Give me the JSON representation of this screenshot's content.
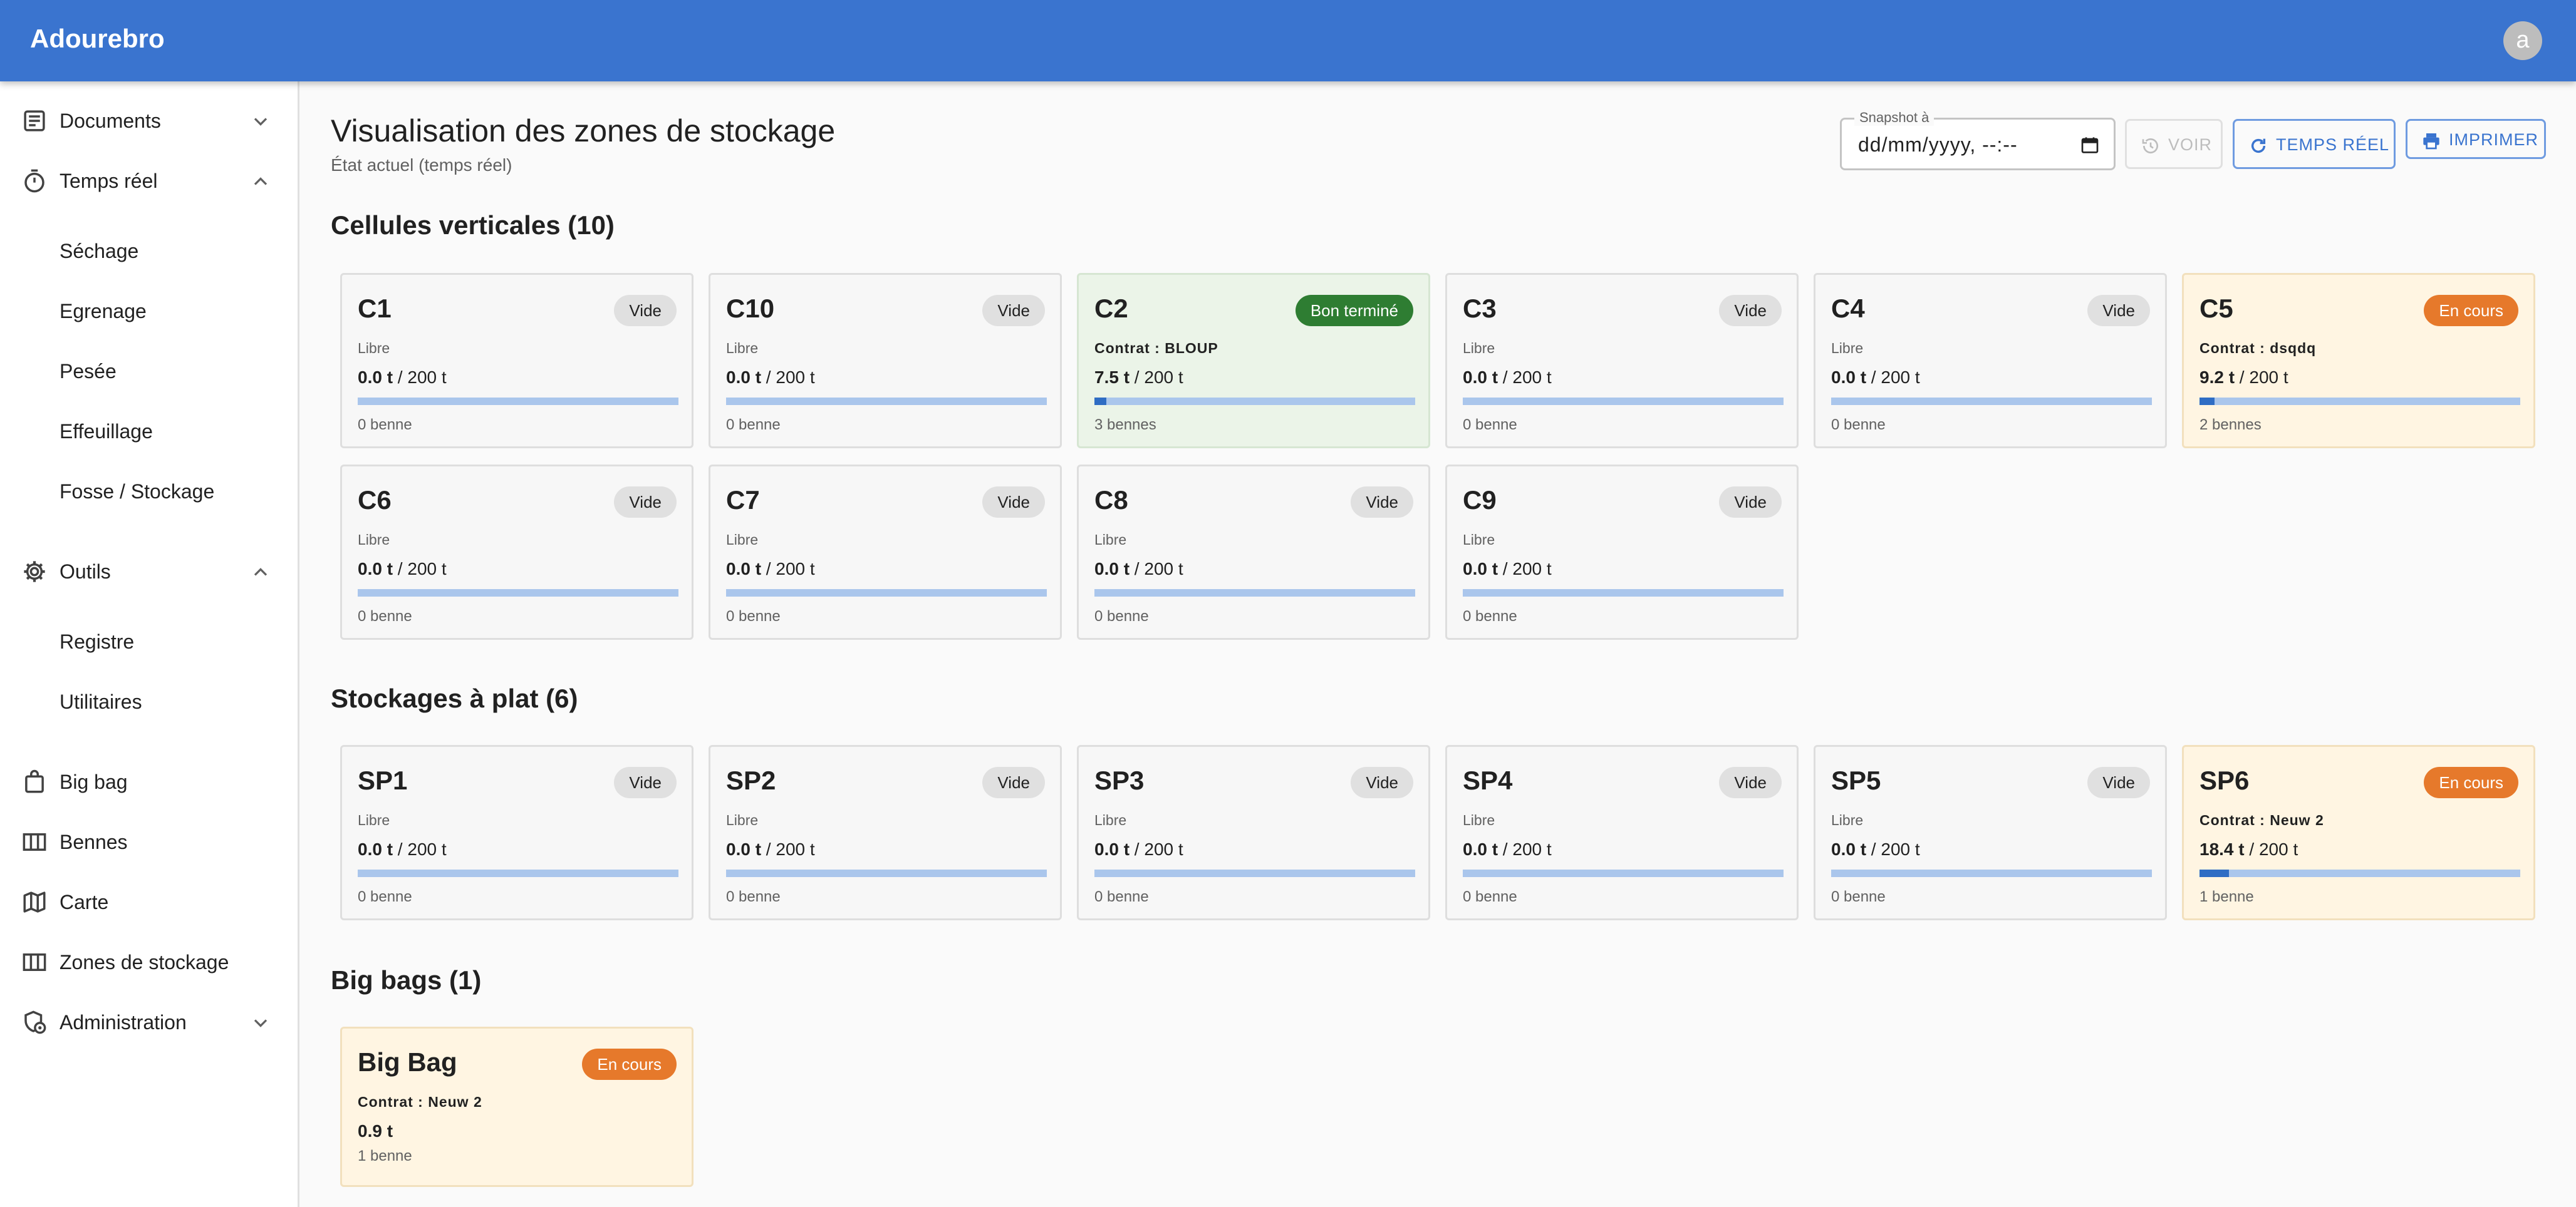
{
  "app": {
    "title": "Adourebro",
    "avatar_letter": "a"
  },
  "sidebar": {
    "documents": "Documents",
    "temps_reel": "Temps réel",
    "temps_reel_items": [
      "Séchage",
      "Egrenage",
      "Pesée",
      "Effeuillage",
      "Fosse / Stockage"
    ],
    "outils": "Outils",
    "outils_items": [
      "Registre",
      "Utilitaires"
    ],
    "big_bag": "Big bag",
    "bennes": "Bennes",
    "carte": "Carte",
    "zones": "Zones de stockage",
    "administration": "Administration"
  },
  "header": {
    "title": "Visualisation des zones de stockage",
    "subtitle": "État actuel (temps réel)",
    "snapshot_label": "Snapshot à",
    "snapshot_value": "dd/mm/yyyy, --:--",
    "voir": "VOIR",
    "temps_reel": "TEMPS RÉEL",
    "imprimer": "IMPRIMER"
  },
  "sections": {
    "cellules": "Cellules verticales (10)",
    "plat": "Stockages à plat (6)",
    "bigbags": "Big bags (1)"
  },
  "cellules": [
    {
      "name": "C1",
      "status": "Vide",
      "kind": "vide",
      "info": "Libre",
      "load": "0.0 t",
      "capacity": " / 200 t",
      "fill": 0,
      "count": "0 benne"
    },
    {
      "name": "C10",
      "status": "Vide",
      "kind": "vide",
      "info": "Libre",
      "load": "0.0 t",
      "capacity": " / 200 t",
      "fill": 0,
      "count": "0 benne"
    },
    {
      "name": "C2",
      "status": "Bon terminé",
      "kind": "done",
      "info": "Contrat : BLOUP",
      "load": "7.5 t",
      "capacity": " / 200 t",
      "fill": 0.0375,
      "count": "3 bennes"
    },
    {
      "name": "C3",
      "status": "Vide",
      "kind": "vide",
      "info": "Libre",
      "load": "0.0 t",
      "capacity": " / 200 t",
      "fill": 0,
      "count": "0 benne"
    },
    {
      "name": "C4",
      "status": "Vide",
      "kind": "vide",
      "info": "Libre",
      "load": "0.0 t",
      "capacity": " / 200 t",
      "fill": 0,
      "count": "0 benne"
    },
    {
      "name": "C5",
      "status": "En cours",
      "kind": "cours",
      "info": "Contrat : dsqdq",
      "load": "9.2 t",
      "capacity": " / 200 t",
      "fill": 0.046,
      "count": "2 bennes"
    },
    {
      "name": "C6",
      "status": "Vide",
      "kind": "vide",
      "info": "Libre",
      "load": "0.0 t",
      "capacity": " / 200 t",
      "fill": 0,
      "count": "0 benne"
    },
    {
      "name": "C7",
      "status": "Vide",
      "kind": "vide",
      "info": "Libre",
      "load": "0.0 t",
      "capacity": " / 200 t",
      "fill": 0,
      "count": "0 benne"
    },
    {
      "name": "C8",
      "status": "Vide",
      "kind": "vide",
      "info": "Libre",
      "load": "0.0 t",
      "capacity": " / 200 t",
      "fill": 0,
      "count": "0 benne"
    },
    {
      "name": "C9",
      "status": "Vide",
      "kind": "vide",
      "info": "Libre",
      "load": "0.0 t",
      "capacity": " / 200 t",
      "fill": 0,
      "count": "0 benne"
    }
  ],
  "plat": [
    {
      "name": "SP1",
      "status": "Vide",
      "kind": "vide",
      "info": "Libre",
      "load": "0.0 t",
      "capacity": " / 200 t",
      "fill": 0,
      "count": "0 benne"
    },
    {
      "name": "SP2",
      "status": "Vide",
      "kind": "vide",
      "info": "Libre",
      "load": "0.0 t",
      "capacity": " / 200 t",
      "fill": 0,
      "count": "0 benne"
    },
    {
      "name": "SP3",
      "status": "Vide",
      "kind": "vide",
      "info": "Libre",
      "load": "0.0 t",
      "capacity": " / 200 t",
      "fill": 0,
      "count": "0 benne"
    },
    {
      "name": "SP4",
      "status": "Vide",
      "kind": "vide",
      "info": "Libre",
      "load": "0.0 t",
      "capacity": " / 200 t",
      "fill": 0,
      "count": "0 benne"
    },
    {
      "name": "SP5",
      "status": "Vide",
      "kind": "vide",
      "info": "Libre",
      "load": "0.0 t",
      "capacity": " / 200 t",
      "fill": 0,
      "count": "0 benne"
    },
    {
      "name": "SP6",
      "status": "En cours",
      "kind": "cours",
      "info": "Contrat : Neuw 2",
      "load": "18.4 t",
      "capacity": " / 200 t",
      "fill": 0.092,
      "count": "1 benne"
    }
  ],
  "bigbags": [
    {
      "name": "Big Bag",
      "status": "En cours",
      "kind": "cours",
      "info": "Contrat : Neuw 2",
      "load": "0.9 t",
      "count": "1 benne"
    }
  ],
  "colors": {
    "appbar": "#3a74cf",
    "done": "#2e7d32",
    "in_progress": "#e6792b",
    "bar": "#aac6ec",
    "bar_fill": "#2f6dc4"
  }
}
